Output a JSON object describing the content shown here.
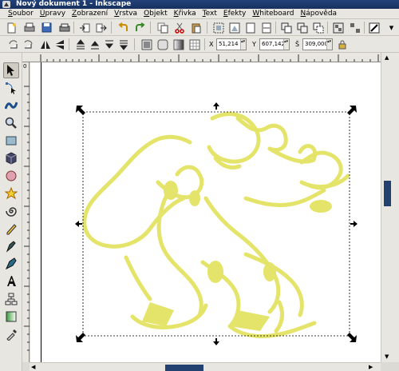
{
  "window": {
    "title": "Nový dokument 1 - Inkscape"
  },
  "menu": [
    "Soubor",
    "Úpravy",
    "Zobrazení",
    "Vrstva",
    "Objekt",
    "Křivka",
    "Text",
    "Efekty",
    "Whiteboard",
    "Nápověda"
  ],
  "controls": {
    "x_label": "X",
    "x_value": "51,214",
    "y_label": "Y",
    "y_value": "607,142",
    "w_label": "Š",
    "w_value": "309,000"
  },
  "rulers": {
    "vertical_tick_text": "0"
  },
  "colors": {
    "drawing_stroke": "#e4e46a",
    "selection_dash": "#000000",
    "scroll_thumb": "#224070",
    "titlebar": "#1c3a6f"
  },
  "icons": {
    "commands": [
      "new-document-icon",
      "open-icon",
      "save-icon",
      "print-icon",
      "import-icon",
      "export-icon",
      "undo-icon",
      "redo-icon",
      "copy-icon",
      "cut-icon",
      "paste-icon",
      "zoom-selection-icon",
      "zoom-drawing-icon",
      "zoom-page-icon",
      "duplicate-icon",
      "clone-icon",
      "unlink-clone-icon",
      "group-icon",
      "ungroup-icon",
      "fill-stroke-icon",
      "text-font-icon",
      "align-icon",
      "xml-editor-icon",
      "preferences-icon"
    ],
    "tools": [
      "selector-tool-icon",
      "node-tool-icon",
      "tweak-tool-icon",
      "zoom-tool-icon",
      "rectangle-tool-icon",
      "3d-box-tool-icon",
      "ellipse-tool-icon",
      "star-tool-icon",
      "spiral-tool-icon",
      "pencil-tool-icon",
      "pen-tool-icon",
      "calligraphy-tool-icon",
      "text-tool-icon",
      "connector-tool-icon",
      "gradient-tool-icon",
      "dropper-tool-icon"
    ]
  }
}
